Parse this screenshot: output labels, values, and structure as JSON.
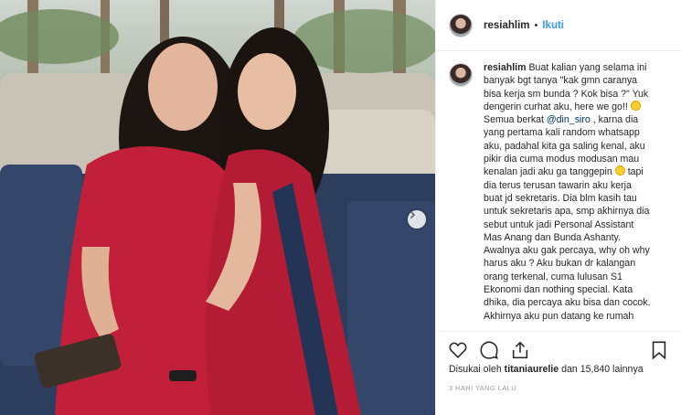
{
  "post": {
    "username": "resiahlim",
    "follow_label": "Ikuti",
    "separator": "•",
    "caption_lines": [
      "Buat kalian yang selama ini",
      "banyak bgt tanya \"kak gmn caranya",
      "bisa kerja sm bunda ? Kok bisa ?\" Yuk",
      "dengerin curhat aku, here we go!!",
      "Semua berkat",
      ", karna dia",
      "yang pertama kali random whatsapp",
      "aku, padahal kita ga saling kenal, aku",
      "pikir dia cuma modus modusan mau",
      "kenalan jadi aku ga tanggepin",
      "tapi",
      "dia terus terusan tawarin aku kerja",
      "buat jd sekretaris. Dia blm kasih tau",
      "untuk sekretaris apa, smp akhirnya dia",
      "sebut untuk jadi Personal Assistant",
      "Mas Anang dan Bunda Ashanty.",
      "Awalnya aku gak percaya, why oh why",
      "harus aku ? Aku bukan dr kalangan",
      "orang terkenal, cuma lulusan S1",
      "Ekonomi dan nothing special. Kata",
      "dhika, dia percaya aku bisa dan cocok.",
      "Akhirnya aku pun datang ke rumah"
    ],
    "mention": "@din_siro",
    "likes_prefix": "Disukai oleh",
    "liked_by": "titaniaurelie",
    "likes_suffix": "dan 15,840 lainnya",
    "timestamp": "3 HARI YANG LALU"
  },
  "icons": {
    "like": "heart-icon",
    "comment": "comment-icon",
    "share": "share-icon",
    "save": "bookmark-icon",
    "next": "chevron-right-icon"
  }
}
